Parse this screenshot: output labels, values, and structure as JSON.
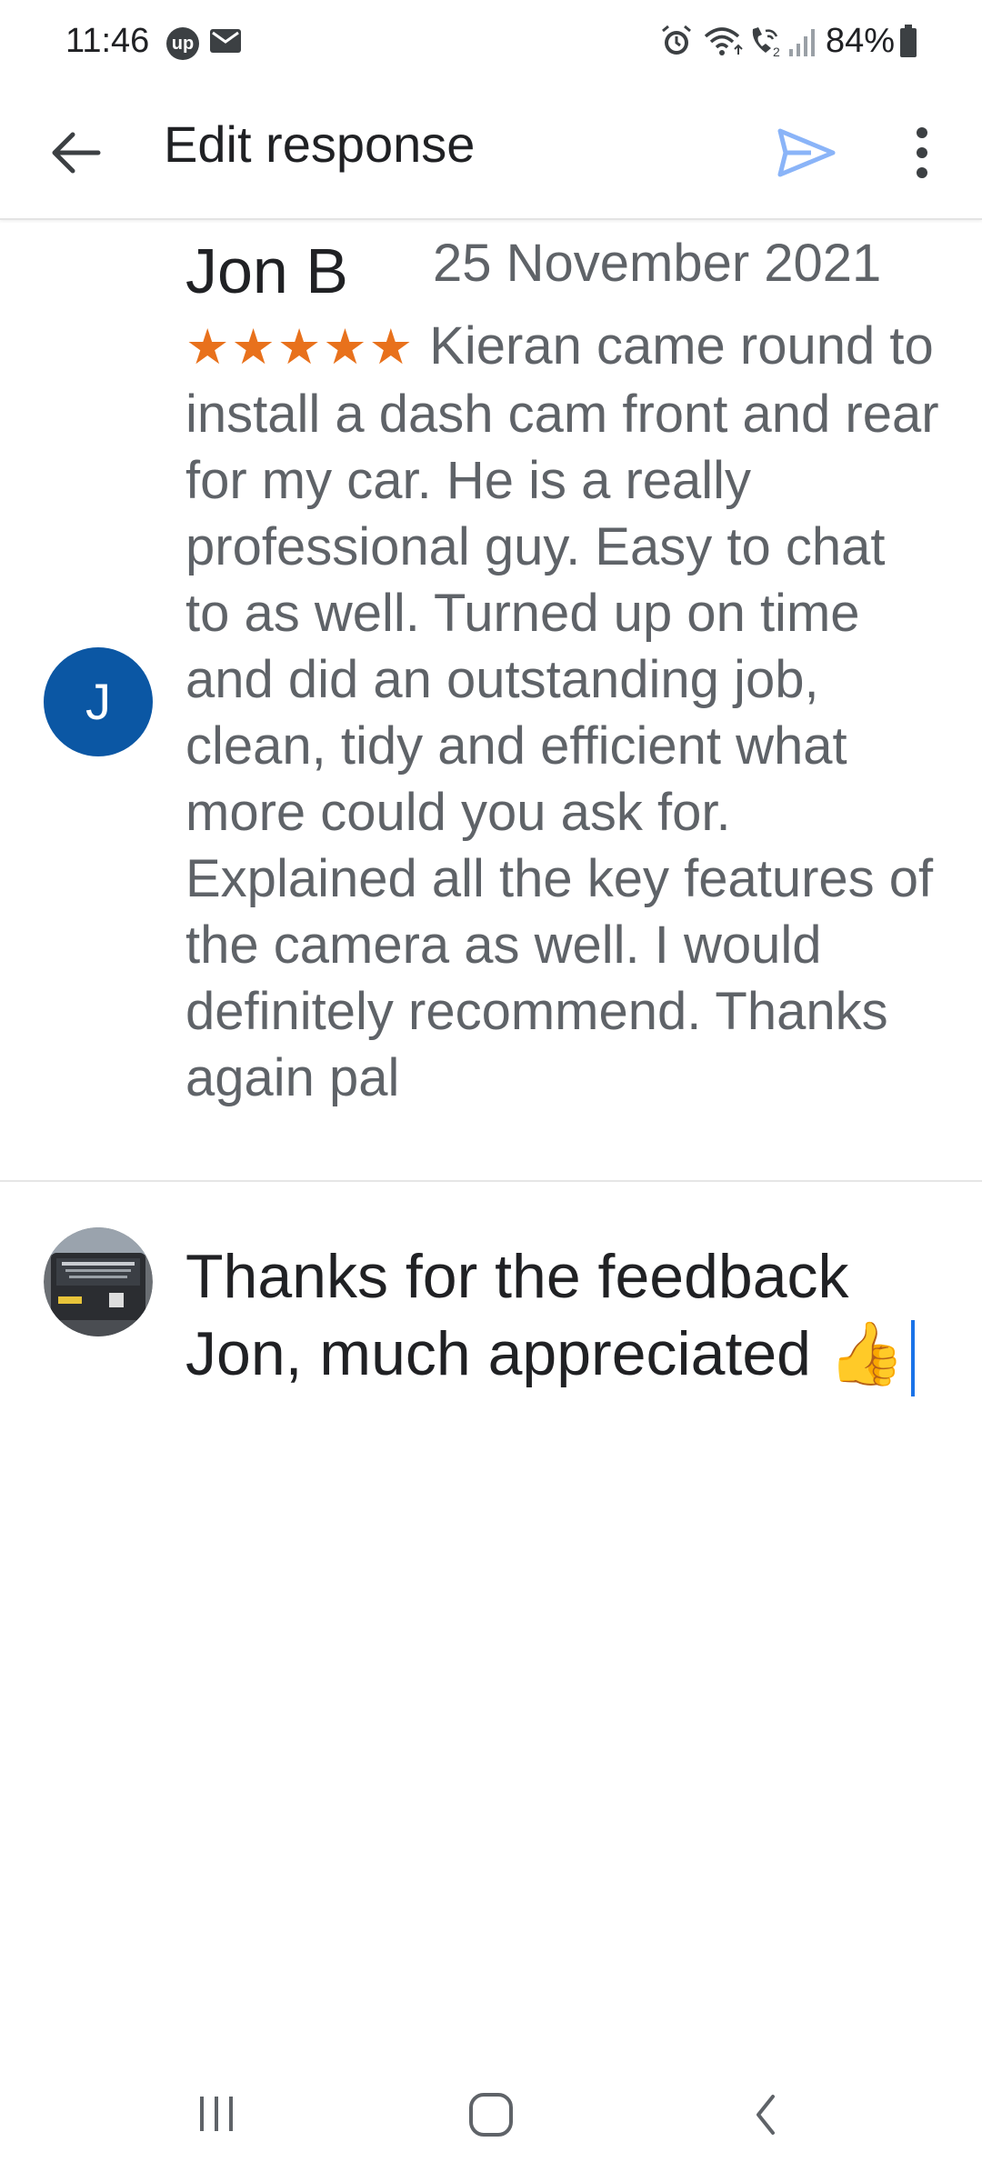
{
  "status_bar": {
    "time": "11:46",
    "up_badge": "up",
    "battery_percent": "84%",
    "icons": [
      "up-badge-icon",
      "mail-icon",
      "alarm-icon",
      "wifi-icon",
      "wifi-calling-icon",
      "signal-icon",
      "battery-icon"
    ]
  },
  "app_bar": {
    "title": "Edit response",
    "back_icon": "arrow-back-icon",
    "send_icon": "send-icon",
    "more_icon": "more-vertical-icon",
    "send_color": "#8ab4f8"
  },
  "review": {
    "avatar_letter": "J",
    "avatar_color": "#0b57a4",
    "reviewer": "Jon B",
    "date": "25 November 2021",
    "stars": "★★★★★",
    "rating": 5,
    "text": "Kieran came round to install a dash cam front and rear for my car. He is a really professional guy. Easy to chat to as well. Turned up on time and did an outstanding job, clean, tidy and efficient what more could you ask for. Explained all the key features of the camera as well. I would definitely recommend. Thanks again pal"
  },
  "response": {
    "text": "Thanks for the feedback Jon, much appreciated 👍"
  },
  "nav_bar": {
    "icons": [
      "recents-icon",
      "home-icon",
      "back-icon"
    ]
  }
}
